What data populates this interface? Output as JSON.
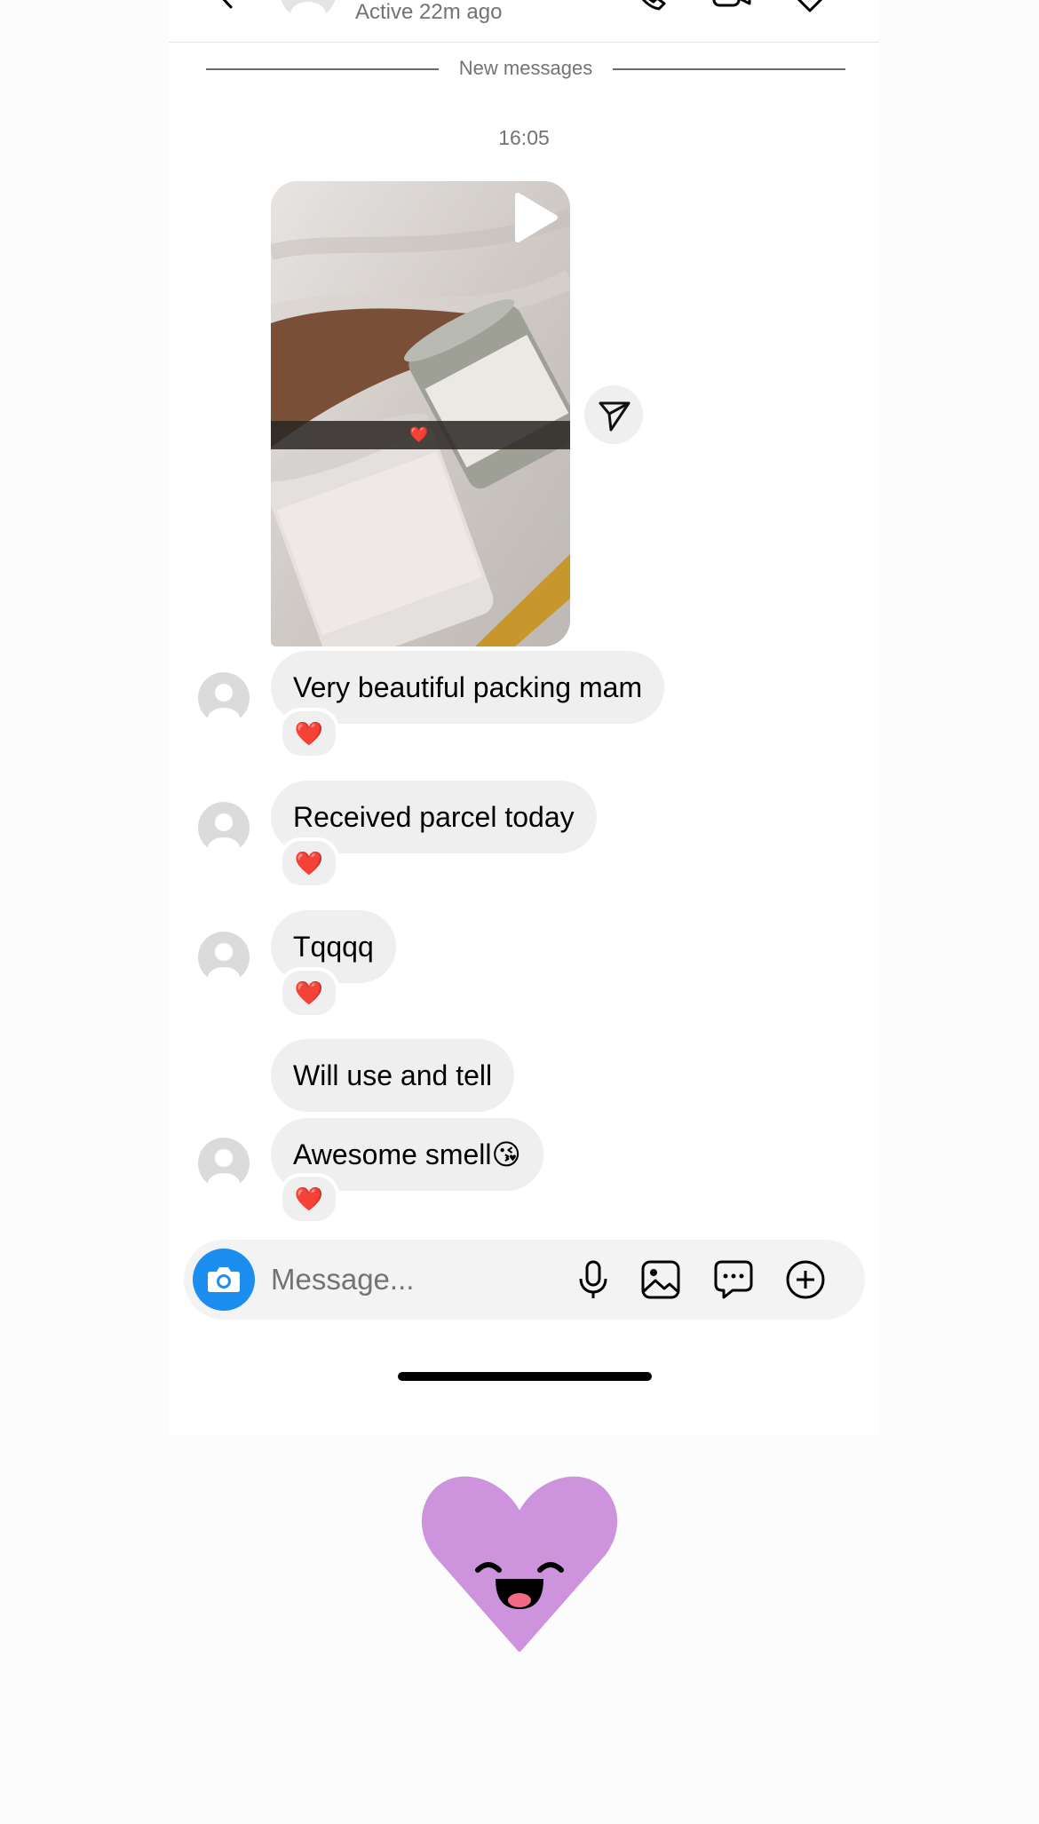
{
  "header": {
    "active_status": "Active 22m ago"
  },
  "divider_label": "New messages",
  "timestamp": "16:05",
  "video_message": {
    "reaction": "❤️"
  },
  "messages": [
    {
      "text": "Very beautiful packing mam",
      "reaction": "❤️"
    },
    {
      "text": "Received parcel today",
      "reaction": "❤️"
    },
    {
      "text": "Tqqqq",
      "reaction": "❤️"
    },
    {
      "text": "Will use and tell",
      "reaction": ""
    },
    {
      "text": "Awesome smell😘",
      "reaction": "❤️"
    }
  ],
  "composer": {
    "placeholder": "Message..."
  },
  "colors": {
    "camera_button": "#1c8ef0",
    "bubble": "#efefef",
    "sticker": "#cd93dd"
  },
  "icons": [
    "back-icon",
    "phone-icon",
    "video-call-icon",
    "heart-icon",
    "play-icon",
    "share-icon",
    "camera-icon",
    "microphone-icon",
    "gallery-icon",
    "sticker-icon",
    "plus-icon"
  ]
}
